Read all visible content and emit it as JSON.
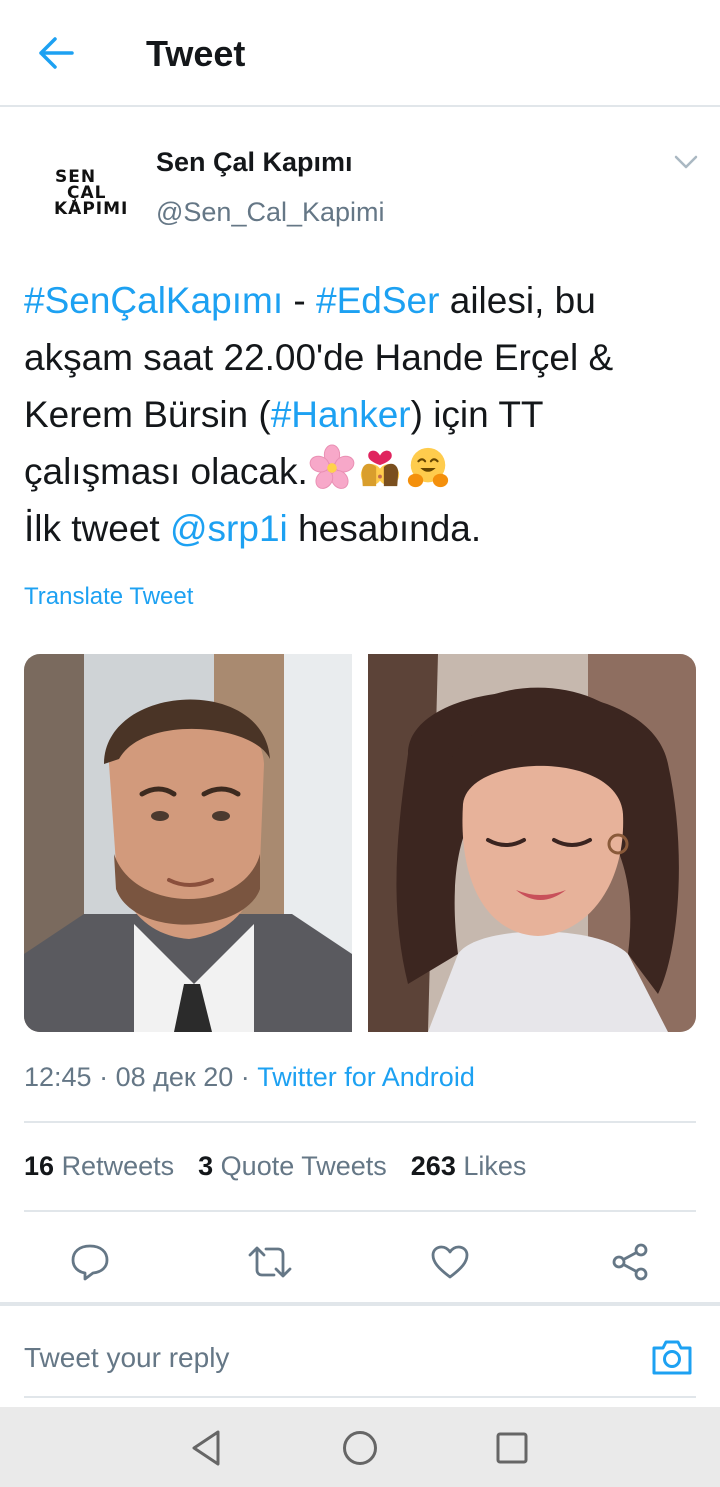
{
  "topbar": {
    "title": "Tweet",
    "back_icon": "arrow-left-icon"
  },
  "author": {
    "display_name": "Sen Çal Kapımı",
    "handle": "@Sen_Cal_Kapimi",
    "avatar_logo": [
      "SEN",
      "ÇAL",
      "KAPIMI"
    ]
  },
  "tweet": {
    "segments": [
      {
        "text": "#SenÇalKapımı",
        "kind": "hashtag"
      },
      {
        "text": " - ",
        "kind": "plain"
      },
      {
        "text": "#EdSer",
        "kind": "hashtag"
      },
      {
        "text": " ailesi, bu akşam saat 22.00'de Hande Erçel & Kerem Bürsin (",
        "kind": "plain"
      },
      {
        "text": "#Hanker",
        "kind": "hashtag"
      },
      {
        "text": ") için TT çalışması olacak.",
        "kind": "plain"
      },
      {
        "text": "İlk tweet ",
        "kind": "plain"
      },
      {
        "text": "@srp1i",
        "kind": "mention"
      },
      {
        "text": " hesabında.",
        "kind": "plain"
      }
    ],
    "emojis": [
      "cherry-blossom-emoji",
      "couple-kiss-emoji",
      "hugging-face-emoji"
    ],
    "translate_label": "Translate Tweet"
  },
  "meta": {
    "time": "12:45",
    "date": "08 дек 20",
    "separator": " · ",
    "source": "Twitter for Android"
  },
  "stats": {
    "retweets_count": "16",
    "retweets_label": "Retweets",
    "quotes_count": "3",
    "quotes_label": "Quote Tweets",
    "likes_count": "263",
    "likes_label": "Likes"
  },
  "actions": [
    "reply-icon",
    "retweet-icon",
    "like-icon",
    "share-icon"
  ],
  "reply": {
    "placeholder": "Tweet your reply",
    "camera_icon": "camera-icon"
  },
  "colors": {
    "accent": "#1da1f2",
    "secondary_text": "#657786",
    "divider": "#e1e6ea",
    "navbar": "#eaeaea"
  }
}
